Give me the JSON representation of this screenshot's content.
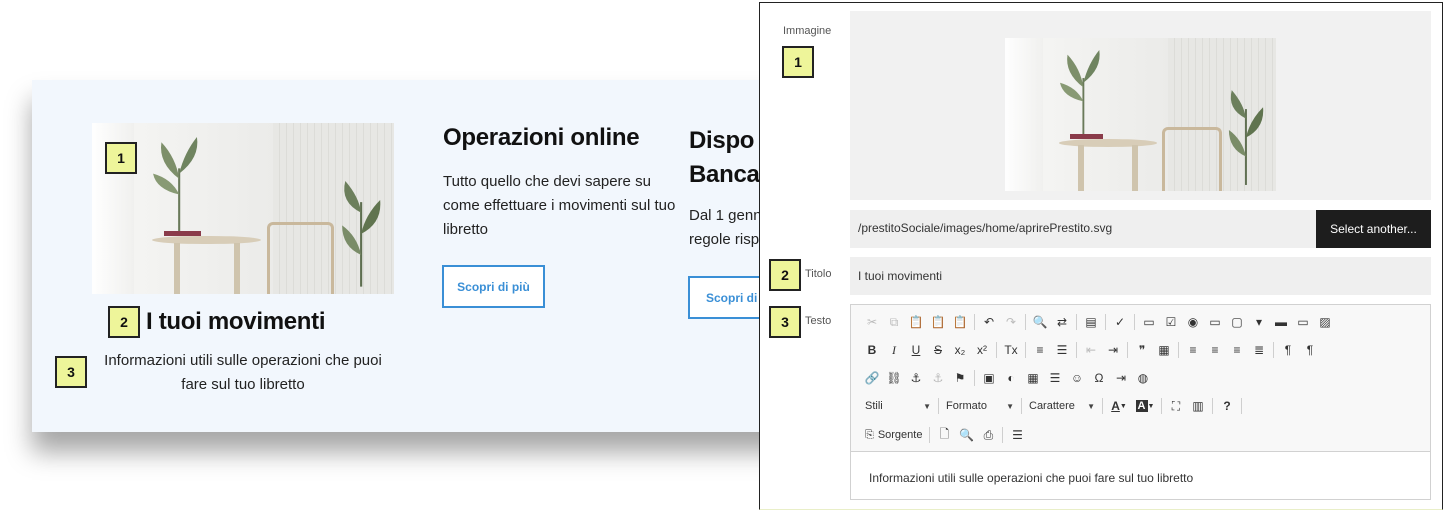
{
  "preview": {
    "card1": {
      "callout_image": "1",
      "callout_title": "2",
      "callout_text": "3",
      "title": "I tuoi movimenti",
      "text": "Informazioni utili sulle operazioni che puoi fare sul tuo libretto"
    },
    "card2": {
      "title": "Operazioni online",
      "text_lines": [
        "Tutto quello che devi sapere su",
        "come effettuare i movimenti sul tuo",
        "libretto"
      ],
      "cta": "Scopri di più"
    },
    "card3": {
      "title_lines": [
        "Dispo",
        "Banca"
      ],
      "text_lines": [
        "Dal 1 genn",
        "regole risp"
      ],
      "cta": "Scopri di p"
    }
  },
  "editor": {
    "label_image": "Immagine",
    "label_title": "Titolo",
    "label_text": "Testo",
    "callout_image": "1",
    "callout_title": "2",
    "callout_text": "3",
    "image_path": "/prestitoSociale/images/home/aprirePrestito.svg",
    "select_button": "Select another...",
    "title_value": "I tuoi movimenti",
    "toolbar": {
      "row1": [
        "cut-icon",
        "copy-icon",
        "paste-icon",
        "paste-text-icon",
        "paste-word-icon",
        "|",
        "undo-icon",
        "redo-icon",
        "|",
        "find-icon",
        "replace-icon",
        "|",
        "select-all-icon",
        "|",
        "spellcheck-icon",
        "|",
        "form-icon",
        "checkbox-icon",
        "radio-icon",
        "textfield-icon",
        "textarea-icon",
        "select-field-icon",
        "button-icon",
        "image-button-icon",
        "hidden-field-icon"
      ],
      "row2": [
        "bold-icon",
        "italic-icon",
        "underline-icon",
        "strike-icon",
        "subscript-icon",
        "superscript-icon",
        "|",
        "remove-format-icon",
        "|",
        "numbered-list-icon",
        "bulleted-list-icon",
        "|",
        "outdent-icon",
        "indent-icon",
        "|",
        "blockquote-icon",
        "div-icon",
        "|",
        "align-left-icon",
        "align-center-icon",
        "align-right-icon",
        "justify-icon",
        "|",
        "ltr-icon",
        "rtl-icon"
      ],
      "row3": [
        "link-icon",
        "unlink-icon",
        "anchor-icon",
        "anchor-remove-icon",
        "flag-icon",
        "|",
        "image-icon",
        "flash-icon",
        "table-icon",
        "horizontal-rule-icon",
        "smiley-icon",
        "special-char-icon",
        "page-break-icon",
        "iframe-icon"
      ],
      "styles": "Stili",
      "format": "Formato",
      "font": "Carattere",
      "source": "Sorgente"
    },
    "content_text": "Informazioni utili sulle operazioni che puoi fare sul tuo libretto"
  }
}
